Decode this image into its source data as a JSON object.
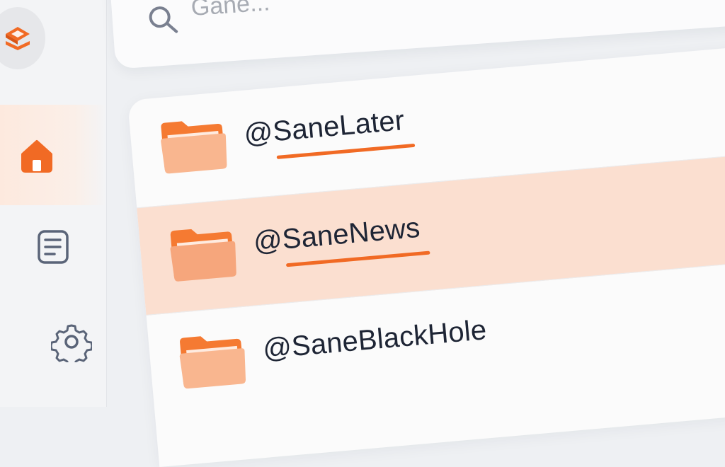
{
  "search": {
    "value": "",
    "placeholder": "Gane..."
  },
  "sidebar": {
    "items": [
      {
        "name": "logo",
        "icon": "stack-icon"
      },
      {
        "name": "home",
        "icon": "home-icon",
        "active": true
      },
      {
        "name": "notes",
        "icon": "document-icon"
      },
      {
        "name": "settings",
        "icon": "gear-icon"
      }
    ]
  },
  "folders": [
    {
      "label": "@SaneLater",
      "selected": false,
      "underlined": true
    },
    {
      "label": "@SaneNews",
      "selected": true,
      "underlined": true
    },
    {
      "label": "@SaneBlackHole",
      "selected": false,
      "underlined": false
    }
  ],
  "colors": {
    "accent": "#f16a24",
    "selected_row": "#fbdfd0",
    "folder_front": "#f7a77c",
    "folder_back": "#f57a32"
  }
}
